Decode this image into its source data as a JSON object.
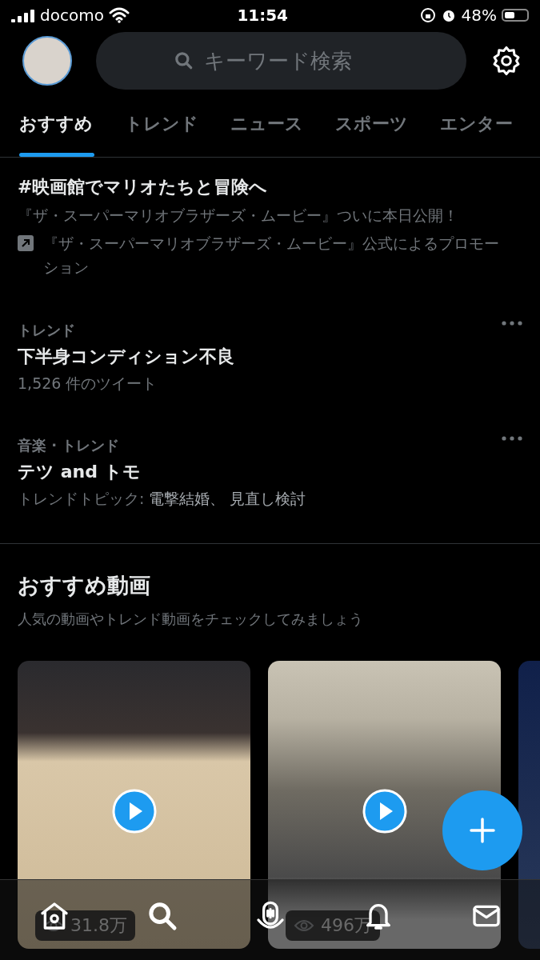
{
  "status_bar": {
    "carrier": "docomo",
    "time": "11:54",
    "battery": "48%"
  },
  "search": {
    "placeholder": "キーワード検索"
  },
  "tabs": [
    {
      "label": "おすすめ",
      "selected": true
    },
    {
      "label": "トレンド",
      "selected": false
    },
    {
      "label": "ニュース",
      "selected": false
    },
    {
      "label": "スポーツ",
      "selected": false
    },
    {
      "label": "エンター",
      "selected": false
    }
  ],
  "trends": [
    {
      "kind": "promoted",
      "title": "#映画館でマリオたちと冒険へ",
      "description": "『ザ・スーパーマリオブラザーズ・ムービー』ついに本日公開！",
      "promoter": "『ザ・スーパーマリオブラザーズ・ムービー』公式によるプロモーション"
    },
    {
      "kind": "trend",
      "category": "トレンド",
      "title": "下半身コンディション不良",
      "meta": "1,526 件のツイート"
    },
    {
      "kind": "trend",
      "category": "音楽 · トレンド",
      "title": "テツ and トモ",
      "meta": "トレンドトピック:",
      "topics": "電撃結婚、 見直し検討"
    }
  ],
  "videos": {
    "title": "おすすめ動画",
    "subtitle": "人気の動画やトレンド動画をチェックしてみましょう",
    "items": [
      {
        "kind": "court",
        "views": "31.8万"
      },
      {
        "kind": "runway",
        "views": "496万"
      },
      {
        "kind": "dark"
      }
    ]
  },
  "nav": [
    {
      "kind": "home",
      "selected": false
    },
    {
      "kind": "search",
      "selected": true
    },
    {
      "kind": "spaces",
      "selected": false
    },
    {
      "kind": "bell",
      "selected": false
    },
    {
      "kind": "mail",
      "selected": false
    }
  ]
}
